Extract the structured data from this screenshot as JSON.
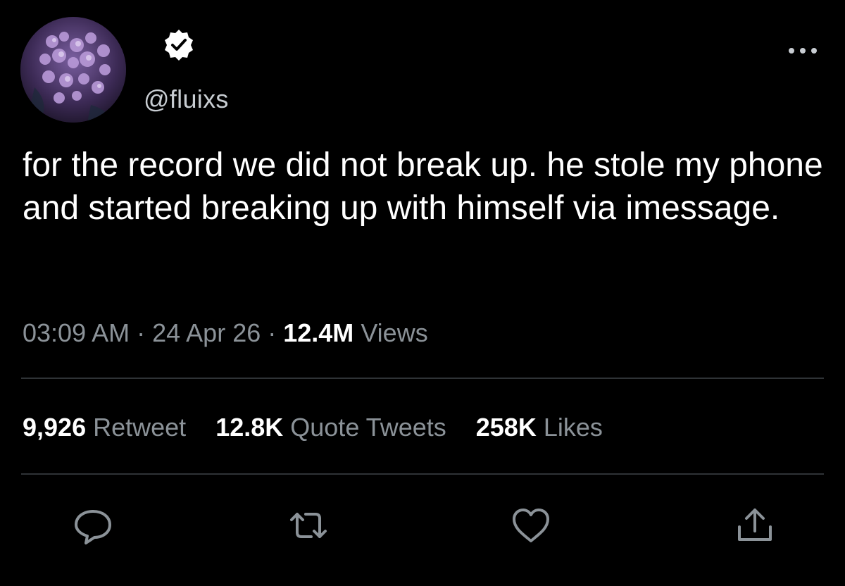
{
  "tweet": {
    "handle": "@fluixs",
    "verified_icon": "verified-badge-icon",
    "text": "for the record we did not break up. he stole my phone and started breaking up with himself via imessage.",
    "time": "03:09 AM",
    "date": "24 Apr 26",
    "separator": "·",
    "views_count": "12.4M",
    "views_label": "Views"
  },
  "stats": {
    "retweets_count": "9,926",
    "retweets_label": "Retweet",
    "quotes_count": "12.8K",
    "quotes_label": "Quote Tweets",
    "likes_count": "258K",
    "likes_label": "Likes"
  },
  "actions": [
    "reply-icon",
    "retweet-icon",
    "like-icon",
    "share-icon"
  ],
  "colors": {
    "background": "#000000",
    "text": "#ffffff",
    "secondary_text": "#8b9298",
    "divider": "#2f3336",
    "icon": "#8b9298"
  }
}
